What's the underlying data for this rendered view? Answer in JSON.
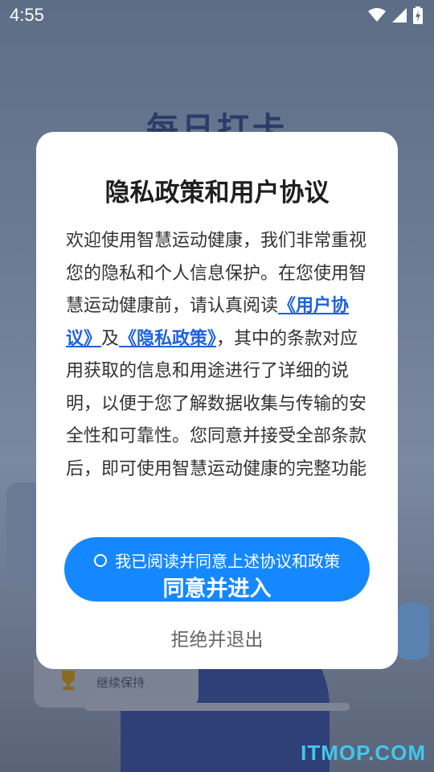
{
  "status_bar": {
    "time": "4:55",
    "icons": [
      "wifi-icon",
      "cell-signal-icon",
      "battery-icon"
    ]
  },
  "background": {
    "title": "每日打卡",
    "keep_going": "继续保持"
  },
  "dialog": {
    "title": "隐私政策和用户协议",
    "body_intro": "欢迎使用智慧运动健康，我们非常重视您的隐私和个人信息保护。在您使用智慧运动健康前，请认真阅读",
    "user_agreement_link": "《用户协议》",
    "and": "及",
    "privacy_policy_link": "《隐私政策》",
    "body_rest": "，其中的条款对应用获取的信息和用途进行了详细的说明，以便于您了解数据收集与传输的安全性和可靠性。您同意并接受全部条款后，即可使用智慧运动健康的完整功能",
    "checkbox_label": "我已阅读并同意上述协议和政策",
    "agree_button": "同意并进入",
    "reject_button": "拒绝并退出"
  },
  "watermark": "ITMOP.COM",
  "colors": {
    "accent": "#1688ff",
    "link": "#1e62e0",
    "watermark": "#3ec8f0"
  }
}
